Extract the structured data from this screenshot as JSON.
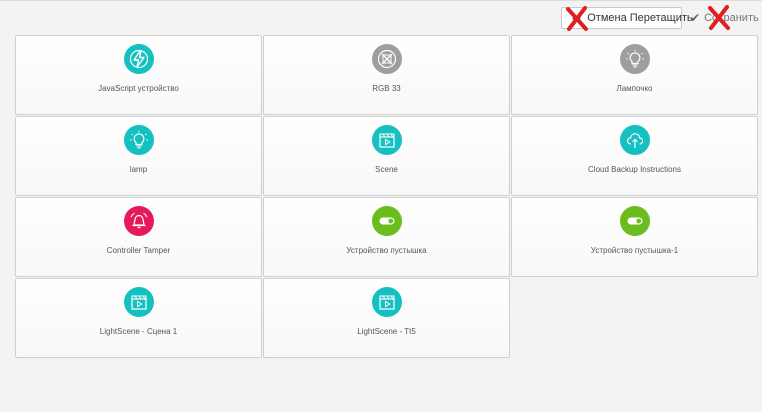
{
  "toolbar": {
    "cancel_label": "Отмена Перетащить",
    "save_label": "Сохранить"
  },
  "colors": {
    "teal": "#14c0c0",
    "gray": "#9e9e9e",
    "red": "#e61a5a",
    "green": "#6bbd1d",
    "x_mark": "#e02020"
  },
  "devices": [
    {
      "name": "JavaScript устройство",
      "icon": "lightning-icon",
      "color": "#14c0c0"
    },
    {
      "name": "RGB 33",
      "icon": "crossed-box-icon",
      "color": "#9e9e9e"
    },
    {
      "name": "Лампочко",
      "icon": "lightbulb-icon",
      "color": "#9e9e9e"
    },
    {
      "name": "lamp",
      "icon": "lightbulb-icon",
      "color": "#14c0c0"
    },
    {
      "name": "Scene",
      "icon": "clapperboard-icon",
      "color": "#14c0c0"
    },
    {
      "name": "Cloud Backup Instructions",
      "icon": "cloud-upload-icon",
      "color": "#14c0c0"
    },
    {
      "name": "Controller Tamper",
      "icon": "alarm-bell-icon",
      "color": "#e61a5a"
    },
    {
      "name": "Устройство пустышка",
      "icon": "toggle-icon",
      "color": "#6bbd1d"
    },
    {
      "name": "Устройство пустышка-1",
      "icon": "toggle-icon",
      "color": "#6bbd1d"
    },
    {
      "name": "LightScene - Сцена 1",
      "icon": "clapperboard-icon",
      "color": "#14c0c0"
    },
    {
      "name": "LightScene - Tt5",
      "icon": "clapperboard-icon",
      "color": "#14c0c0"
    }
  ]
}
